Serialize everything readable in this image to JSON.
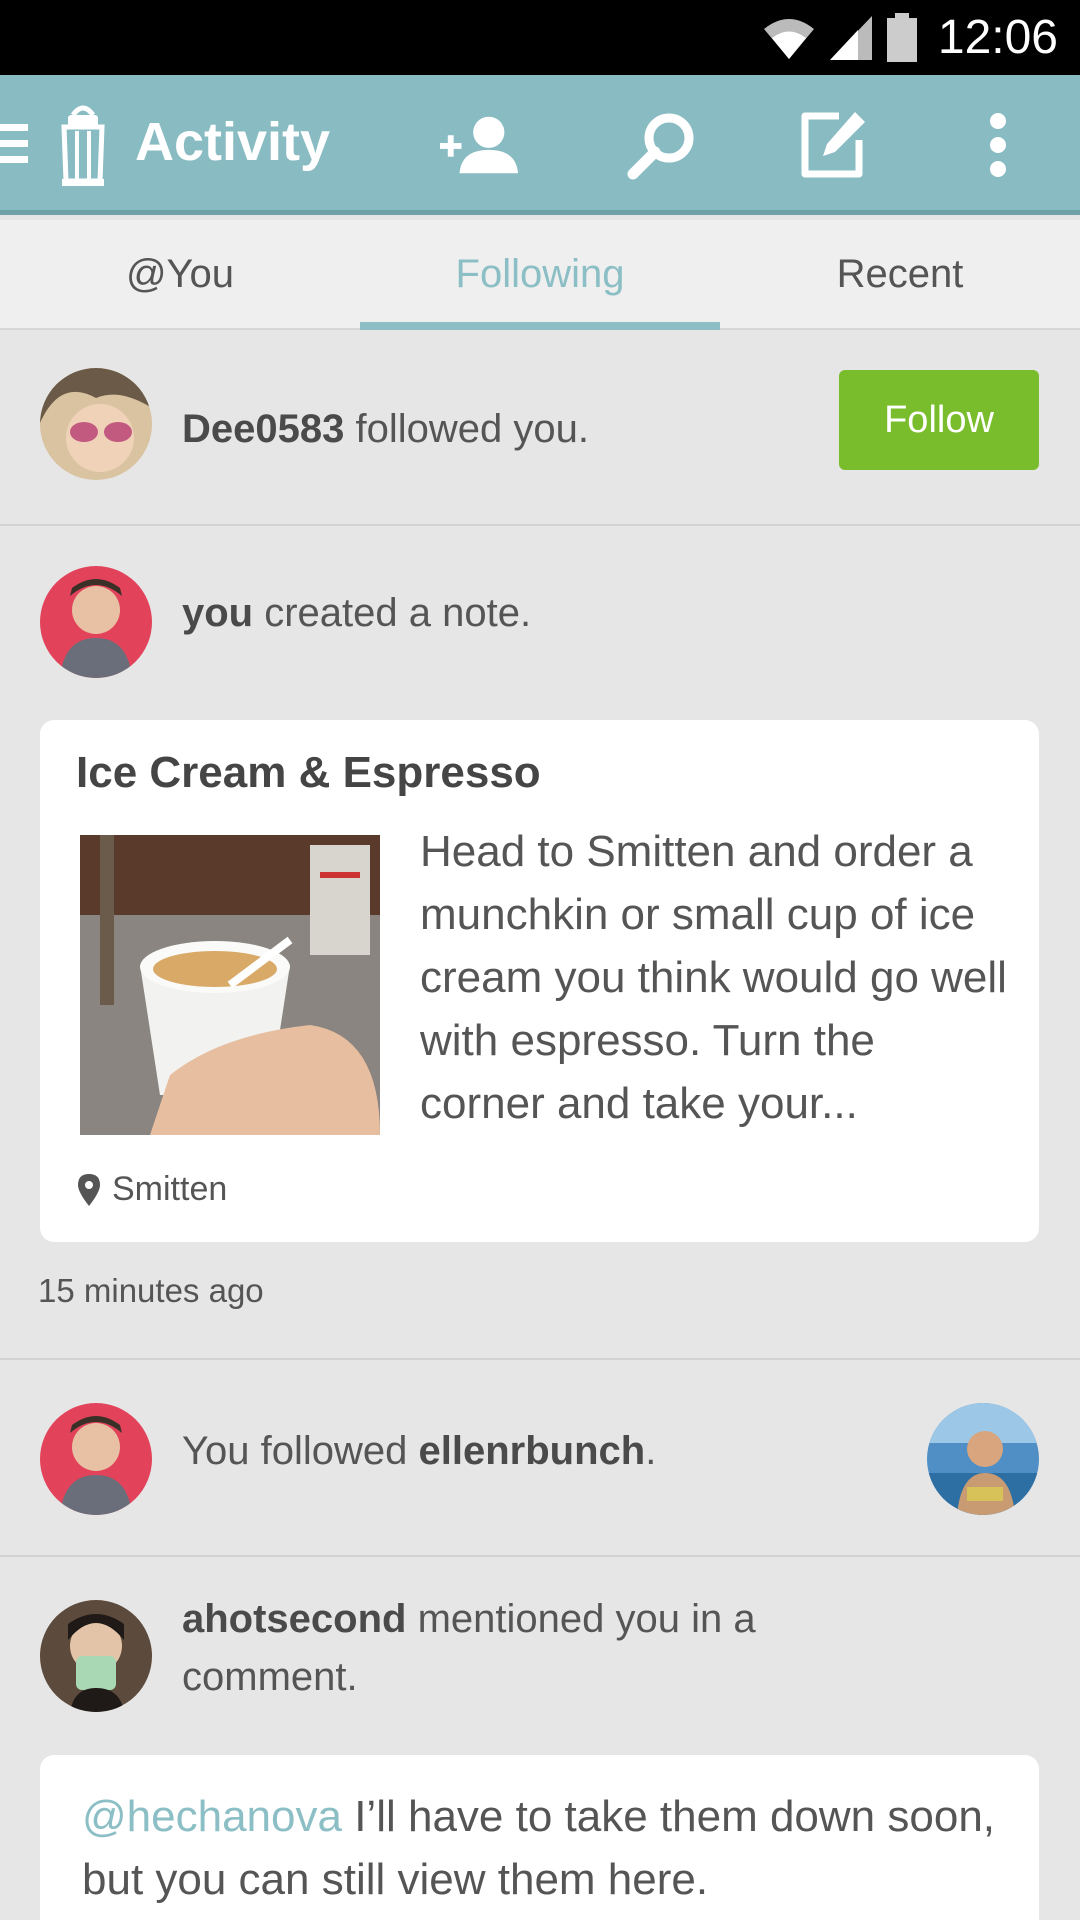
{
  "status_bar": {
    "time": "12:06"
  },
  "app_bar": {
    "title": "Activity"
  },
  "tabs": [
    {
      "label": "@You"
    },
    {
      "label": "Following"
    },
    {
      "label": "Recent"
    }
  ],
  "feed": {
    "item1": {
      "user": "Dee0583",
      "action": " followed you.",
      "button_label": "Follow"
    },
    "item2": {
      "user": "you",
      "action": " created a note.",
      "note": {
        "title": "Ice Cream & Espresso",
        "body": "Head to Smitten and order a munchkin or small cup of ice cream you think would go well with espresso. Turn the corner and take your...",
        "location": "Smitten"
      },
      "time": "15 minutes ago"
    },
    "item3": {
      "prefix": "You followed ",
      "user": "ellenrbunch",
      "suffix": "."
    },
    "item4": {
      "user": "ahotsecond",
      "action": " mentioned you in a comment.",
      "comment": {
        "mention": "@hechanova",
        "text": " I’ll have to take them down soon, but you can still view them here."
      }
    }
  },
  "colors": {
    "app_bar": "#89bcc2",
    "accent": "#8bbfc5",
    "follow_button": "#79bd2c"
  }
}
